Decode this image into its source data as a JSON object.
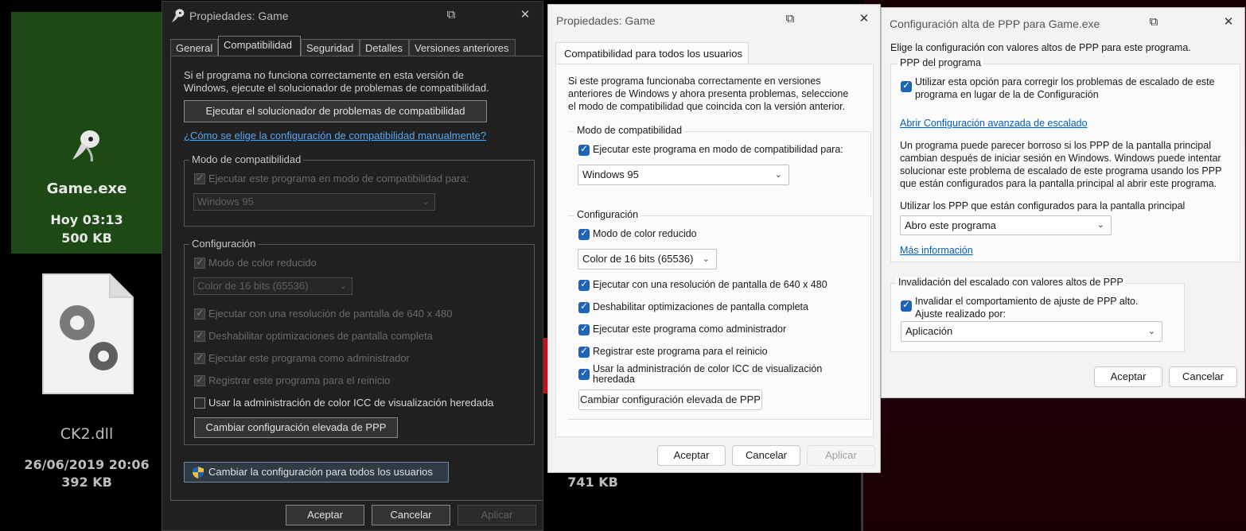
{
  "desktop": {
    "game": {
      "name": "Game.exe",
      "time": "Hoy 03:13",
      "size": "500 KB"
    },
    "ck2": {
      "name": "CK2.dll",
      "date": "26/06/2019 20:06",
      "size": "392 KB"
    },
    "third_size": "741 KB"
  },
  "dark_window": {
    "title": "Propiedades: Game",
    "tabs": [
      "General",
      "Compatibilidad",
      "Seguridad",
      "Detalles",
      "Versiones anteriores"
    ],
    "intro": "Si el programa no funciona correctamente en esta versión de Windows, ejecute el solucionador de problemas de compatibilidad.",
    "intro_line1": "Si el programa no funciona correctamente en esta versión de",
    "intro_line2": "Windows, ejecute el solucionador de problemas de compatibilidad.",
    "troubleshooter_button": "Ejecutar el solucionador de problemas de compatibilidad",
    "manual_link": "¿Cómo se elige la configuración de compatibilidad manualmente?",
    "compat_mode_group": "Modo de compatibilidad",
    "compat_mode_check": "Ejecutar este programa en modo de compatibilidad para:",
    "compat_select": "Windows 95",
    "settings_group": "Configuración",
    "reduced_color": "Modo de color reducido",
    "color_select": "Color de 16 bits (65536)",
    "res_640": "Ejecutar con una resolución de pantalla de 640 x 480",
    "disable_fullscreen": "Deshabilitar optimizaciones de pantalla completa",
    "run_admin": "Ejecutar este programa como administrador",
    "register_restart": "Registrar este programa para el reinicio",
    "icc": "Usar la administración de color ICC de visualización heredada",
    "dpi_button": "Cambiar configuración elevada de PPP",
    "all_users_button": "Cambiar la configuración para todos los usuarios",
    "ok": "Aceptar",
    "cancel": "Cancelar",
    "apply": "Aplicar"
  },
  "mid_window": {
    "title": "Propiedades: Game",
    "tab": "Compatibilidad para todos los usuarios",
    "intro_line1": "Si este programa funcionaba correctamente en versiones",
    "intro_line2": "anteriores de Windows y ahora presenta problemas, seleccione",
    "intro_line3": "el modo de compatibilidad que coincida con la versión anterior.",
    "compat_group": "Modo de compatibilidad",
    "compat_check": "Ejecutar este programa en modo de compatibilidad para:",
    "compat_select": "Windows 95",
    "settings_group": "Configuración",
    "reduced_color": "Modo de color reducido",
    "color_select": "Color de 16 bits (65536)",
    "res_640": "Ejecutar con una resolución de pantalla de 640 x 480",
    "disable_fullscreen": "Deshabilitar optimizaciones de pantalla completa",
    "run_admin": "Ejecutar este programa como administrador",
    "register_restart": "Registrar este programa para el reinicio",
    "icc_line1": "Usar la administración de color ICC de visualización",
    "icc_line2": "heredada",
    "dpi_button": "Cambiar configuración elevada de PPP",
    "ok": "Aceptar",
    "cancel": "Cancelar",
    "apply": "Aplicar"
  },
  "dpi_window": {
    "title": "Configuración alta de PPP para Game.exe",
    "intro": "Elige la configuración con valores altos de PPP para este programa.",
    "program_group": "PPP del programa",
    "use_option_line1": "Utilizar esta opción para corregir los problemas de escalado de este",
    "use_option_line2": "programa en lugar de la de Configuración",
    "advanced_link": "Abrir Configuración avanzada de escalado",
    "blurry_line1": "Un programa puede parecer borroso si los PPP de la pantalla principal",
    "blurry_line2": "cambian después de iniciar sesión en Windows. Windows puede intentar",
    "blurry_line3": "solucionar este problema de escalado de este programa usando los PPP",
    "blurry_line4": "que están configurados para la pantalla principal al abrir este programa.",
    "use_dpi_label": "Utilizar los PPP que están configurados para la pantalla principal",
    "use_dpi_select": "Abro este programa",
    "more_info": "Más información",
    "override_group": "Invalidación del escalado con valores altos de PPP",
    "override_check": "Invalidar el comportamiento de ajuste de PPP alto.",
    "scaling_by": "Ajuste realizado por:",
    "scaling_select": "Aplicación",
    "ok": "Aceptar",
    "cancel": "Cancelar"
  }
}
